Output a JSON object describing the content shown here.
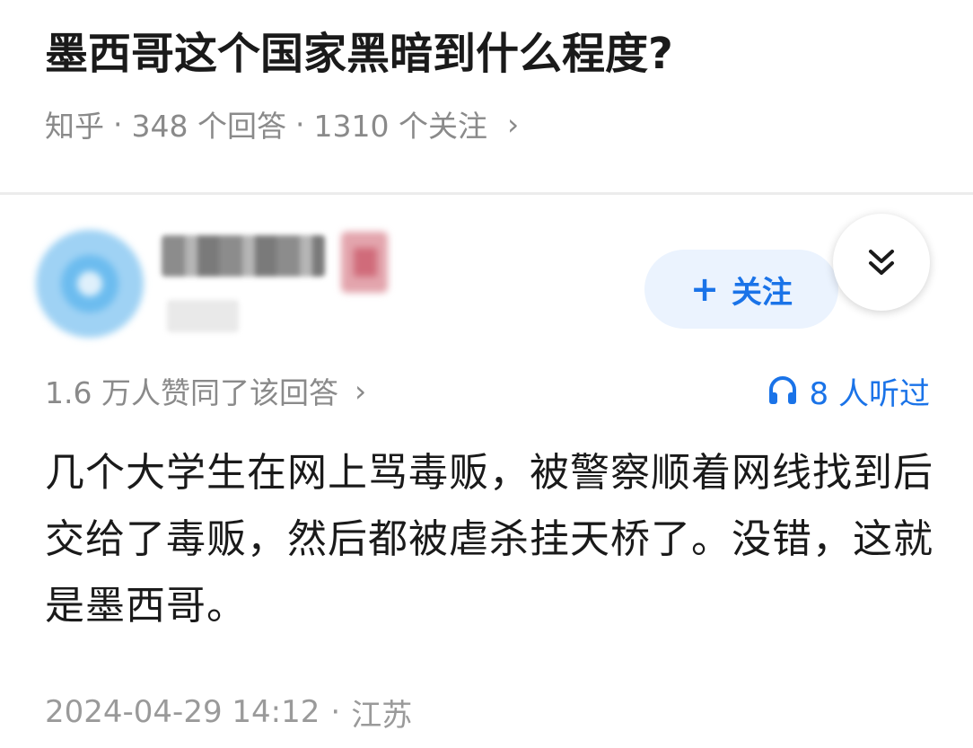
{
  "question": {
    "title": "墨西哥这个国家黑暗到什么程度?",
    "source": "知乎",
    "answer_count": "348 个回答",
    "follower_count": "1310 个关注",
    "separator": "·",
    "chevron": "›"
  },
  "answer": {
    "follow_label": "关注",
    "follow_plus": "+",
    "upvote_text": "1.6 万人赞同了该回答",
    "upvote_chevron": "›",
    "listen_text": "8 人听过",
    "body": "几个大学生在网上骂毒贩，被警察顺着网线找到后交给了毒贩，然后都被虐杀挂天桥了。没错，这就是墨西哥。",
    "timestamp": "2024-04-29 14:12",
    "separator": "·",
    "location": "江苏"
  },
  "colors": {
    "accent": "#1a73e8",
    "follow_bg": "#ebf3fe",
    "muted_text": "#8a8a8a",
    "title_text": "#1a1a1a"
  },
  "icons": {
    "collapse": "double-chevron-down-icon",
    "headphones": "headphones-icon"
  }
}
